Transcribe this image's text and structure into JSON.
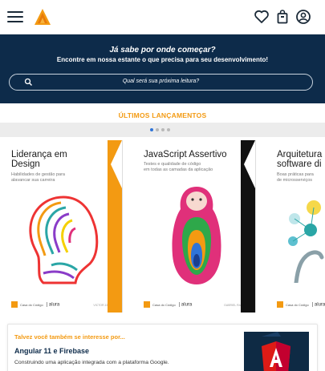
{
  "header": {
    "menu_icon": "hamburger-menu-icon",
    "logo": "alura-triangle-logo",
    "icons": [
      "heart-icon",
      "shopping-bag-icon",
      "user-circle-icon"
    ]
  },
  "banner": {
    "title": "Já sabe por onde começar?",
    "subtitle": "Encontre em nossa estante o que precisa para seu desenvolvimento!",
    "search_placeholder": "Qual será sua próxima leitura?"
  },
  "releases": {
    "title": "ÚLTIMOS LANÇAMENTOS",
    "dots": 4,
    "active_dot": 0,
    "books": [
      {
        "title_line1": "Liderança em",
        "title_line2": "Design",
        "subtitle_line1": "Habilidades de gestão para",
        "subtitle_line2": "alavancar sua carreira",
        "brand": "alura",
        "author": "VICTOR ZANINI",
        "accent": "#f39a12"
      },
      {
        "title_line1": "JavaScript Assertivo",
        "title_line2": "",
        "subtitle_line1": "Testes e qualidade de código",
        "subtitle_line2": "em todas as camadas da aplicação",
        "brand": "alura",
        "author": "GABRIEL RAMOS",
        "accent": "#111111"
      },
      {
        "title_line1": "Arquitetura",
        "title_line2": "software di",
        "subtitle_line1": "Boas práticas para",
        "subtitle_line2": "de microsserviços",
        "brand": "alura",
        "author": "",
        "accent": "#2aa6a6"
      }
    ]
  },
  "suggestion": {
    "hint": "Talvez você também se interesse por...",
    "title": "Angular 11 e Firebase",
    "description": "Construindo uma aplicação integrada com a plataforma Google."
  },
  "colors": {
    "primary_dark": "#0d2b4a",
    "accent_orange": "#f39a12",
    "active_dot": "#2f74d8"
  }
}
